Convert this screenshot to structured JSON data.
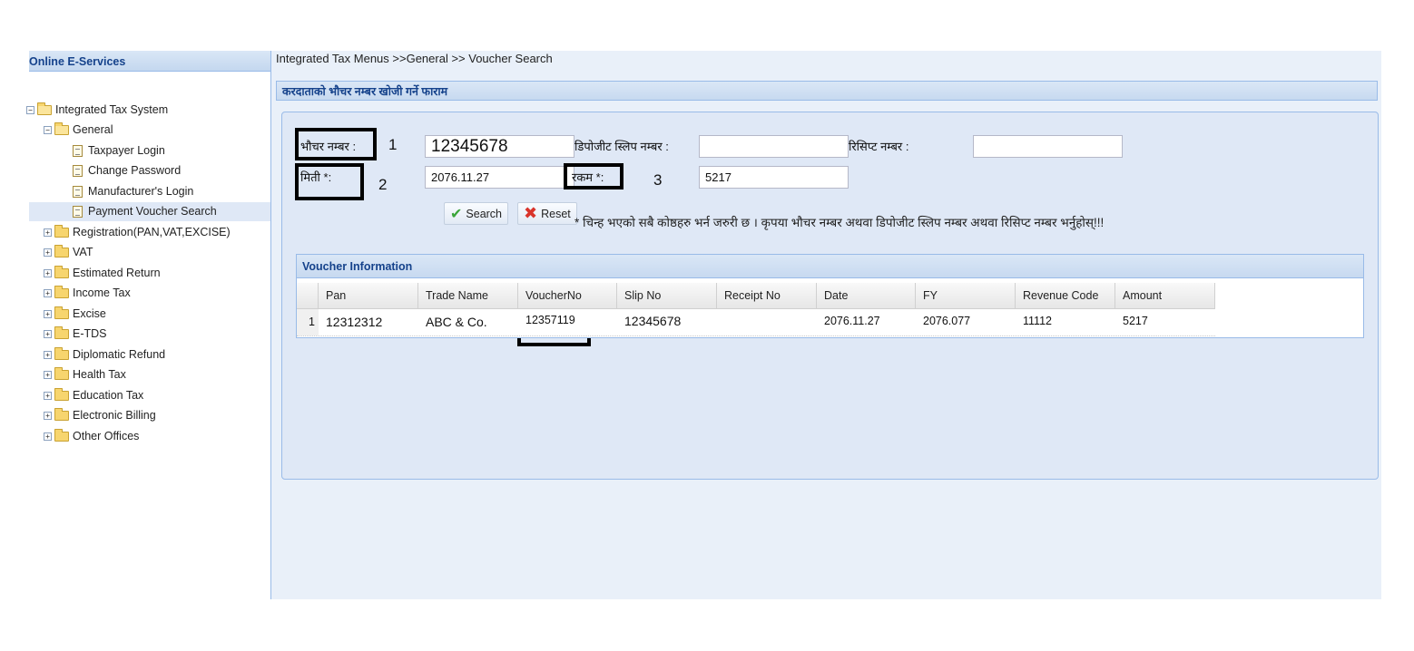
{
  "sidebar": {
    "title": "Online E-Services",
    "root": "Integrated Tax System",
    "general": "General",
    "general_items": [
      "Taxpayer Login",
      "Change Password",
      "Manufacturer's Login",
      "Payment Voucher Search"
    ],
    "folders": [
      "Registration(PAN,VAT,EXCISE)",
      "VAT",
      "Estimated Return",
      "Income Tax",
      "Excise",
      "E-TDS",
      "Diplomatic Refund",
      "Health Tax",
      "Education Tax",
      "Electronic Billing",
      "Other Offices"
    ]
  },
  "breadcrumb": "Integrated Tax Menus >>General >> Voucher Search",
  "form": {
    "title": "करदाताको भौचर नम्बर खोजी गर्ने फाराम",
    "voucher_label": "भौचर नम्बर :",
    "voucher_value": "12345678",
    "deposit_label": "डिपोजीट स्लिप नम्बर :",
    "deposit_value": "",
    "receipt_label": "रिसिप्ट नम्बर :",
    "receipt_value": "",
    "date_label": "मिती *:",
    "date_value": "2076.11.27",
    "amount_label": "रकम *:",
    "amount_value": "5217",
    "search_label": "Search",
    "reset_label": "Reset",
    "note": "* चिन्ह भएको सबै कोष्ठहरु भर्न जरुरी छ । कृपया भौचर नम्बर अथवा डिपोजीट स्लिप नम्बर अथवा रिसिप्ट नम्बर भर्नुहोस्!!!"
  },
  "annotations": [
    "1",
    "2",
    "3"
  ],
  "grid": {
    "title": "Voucher Information",
    "columns": [
      "Pan",
      "Trade Name",
      "VoucherNo",
      "Slip No",
      "Receipt No",
      "Date",
      "FY",
      "Revenue Code",
      "Amount"
    ],
    "rows": [
      {
        "num": "1",
        "pan": "12312312",
        "trade_name": "ABC & Co.",
        "voucher_no": "12357119",
        "slip_no": "12345678",
        "receipt_no": "",
        "date": "2076.11.27",
        "fy": "2076.077",
        "revenue_code": "11112",
        "amount": "5217"
      }
    ]
  },
  "colors": {
    "header_text": "#15428b",
    "panel_bg": "#dfe8f6",
    "border": "#99bbe8"
  }
}
